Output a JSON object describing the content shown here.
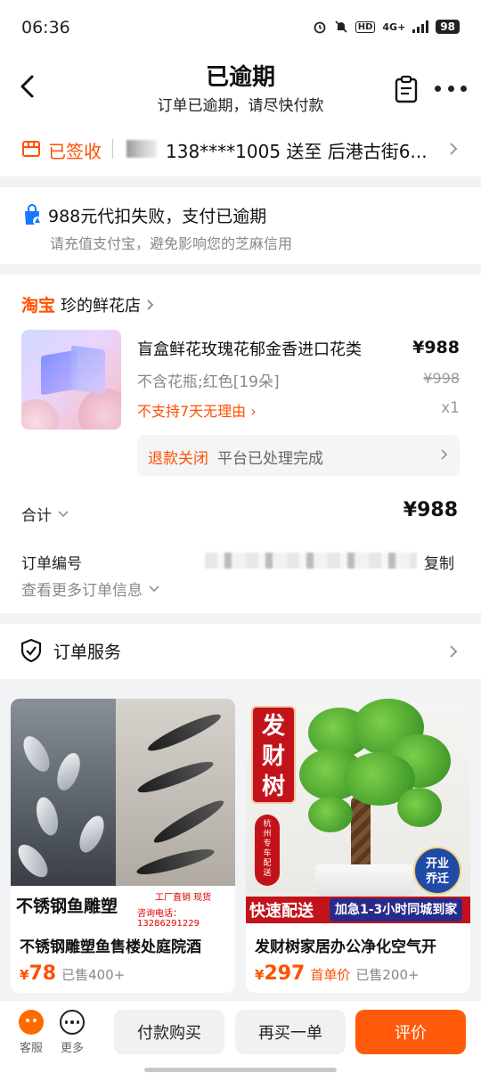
{
  "status_bar": {
    "time": "06:36",
    "network": "4G+",
    "hd": "HD",
    "battery": "98"
  },
  "header": {
    "title": "已逾期",
    "subtitle": "订单已逾期，请尽快付款"
  },
  "delivery": {
    "status": "已签收",
    "address_line": "138****1005 送至 后港古街6..."
  },
  "alert": {
    "line1": "988元代扣失败，支付已逾期",
    "line2": "请充值支付宝，避免影响您的芝麻信用"
  },
  "order": {
    "platform": "淘宝",
    "shop_name": "珍的鲜花店",
    "product_name": "盲盒鲜花玫瑰花郁金香进口花类",
    "price": "¥988",
    "spec": "不含花瓶;红色[19朵]",
    "original_price": "¥998",
    "no_return": "不支持7天无理由",
    "quantity": "x1",
    "refund_status": "退款关闭",
    "refund_desc": "平台已处理完成",
    "total_label": "合计",
    "total_value": "¥988",
    "order_no_label": "订单编号",
    "copy_label": "复制",
    "more_info": "查看更多订单信息"
  },
  "service": {
    "label": "订单服务"
  },
  "recommendations": [
    {
      "title": "不锈钢雕塑鱼售楼处庭院酒",
      "currency": "¥",
      "price": "78",
      "tag": "",
      "sold": "已售400+",
      "banner": "不锈钢鱼雕塑",
      "banner_sub1": "工厂直销 现货",
      "banner_sub2": "咨询电话：13286291229"
    },
    {
      "title": "发财树家居办公净化空气开",
      "currency": "¥",
      "price": "297",
      "tag": "首单价",
      "sold": "已售200+",
      "badge": "发财树",
      "badge_side": "杭州专车配送",
      "badge_round": "开业乔迁",
      "banner": "快速配送",
      "banner_sub": "加急1-3小时同城到家"
    }
  ],
  "bottom_bar": {
    "kefu": "客服",
    "more": "更多",
    "pay": "付款购买",
    "rebuy": "再买一单",
    "review": "评价"
  },
  "colors": {
    "accent": "#ff5000",
    "review_button": "#ff5b0a"
  }
}
